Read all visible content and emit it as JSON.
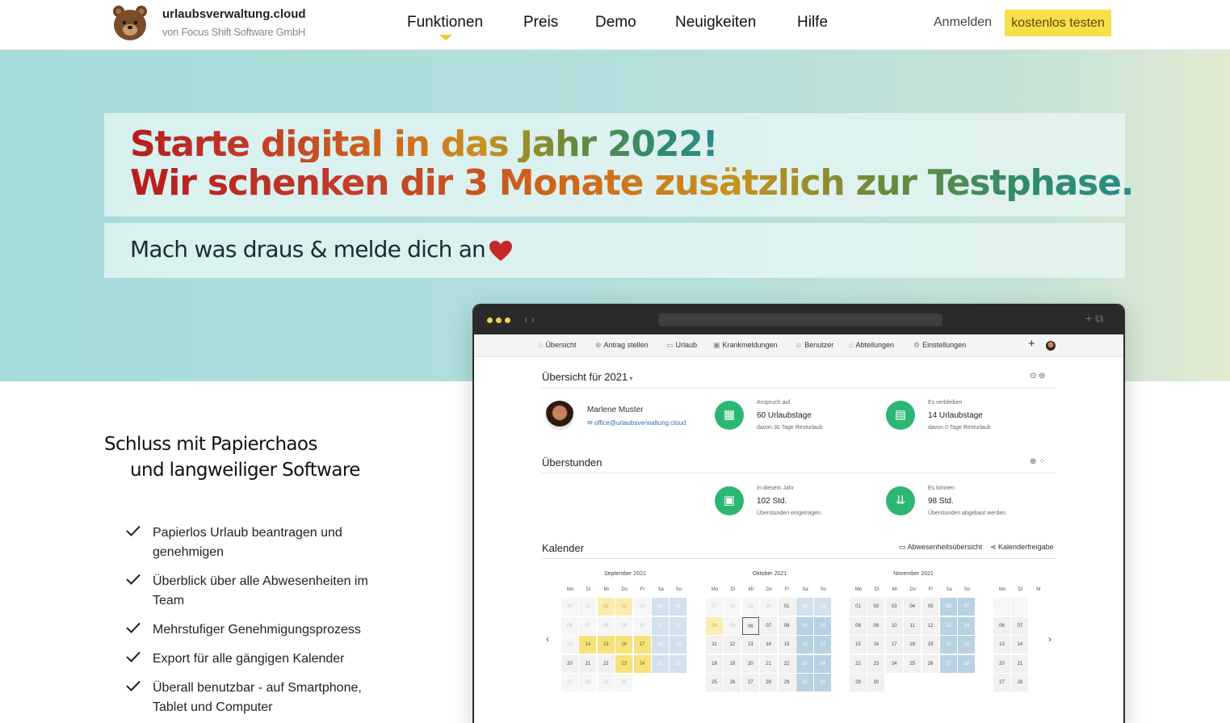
{
  "header": {
    "brand": "urlaubsverwaltung.cloud",
    "brand_sub": "von Focus Shift Software GmbH",
    "nav": [
      "Funktionen",
      "Preis",
      "Demo",
      "Neuigkeiten",
      "Hilfe"
    ],
    "active_nav": "Funktionen",
    "login": "Anmelden",
    "cta": "kostenlos testen"
  },
  "hero": {
    "headline_1": "Starte digital in das Jahr 2022!",
    "headline_2": "Wir schenken dir 3 Monate zusätzlich zur Testphase.",
    "tagline": "Mach was draus & melde dich an"
  },
  "features": {
    "claim_1": "Schluss mit Papierchaos",
    "claim_2": "und langweiliger Software",
    "items": [
      "Papierlos Urlaub beantragen und genehmigen",
      "Überblick über alle Abwesenheiten im Team",
      "Mehrstufiger Genehmigungsprozess",
      "Export für alle gängigen Kalender",
      "Überall benutzbar - auf Smartphone, Tablet und Computer"
    ]
  },
  "app": {
    "nav": [
      "Übersicht",
      "Antrag stellen",
      "Urlaub",
      "Krankmeldungen",
      "Benutzer",
      "Abteilungen",
      "Einstellungen"
    ],
    "overview_title": "Übersicht für 2021",
    "user_name": "Marlene Muster",
    "user_email": "office@urlaubsverwaltung.cloud",
    "claim_label": "Anspruch auf",
    "claim_value": "60 Urlaubstage",
    "claim_sub": "davon 30 Tage Resturlaub",
    "remain_label": "Es verbleiben",
    "remain_value": "14 Urlaubstage",
    "remain_sub": "davon 0 Tage Resturlaub",
    "overtime_title": "Überstunden",
    "ot_year_label": "In diesem Jahr",
    "ot_year_value": "102 Std.",
    "ot_year_sub": "Überstunden eingetragen.",
    "ot_can_label": "Es können",
    "ot_can_value": "98 Std.",
    "ot_can_sub": "Überstunden abgebaut werden.",
    "calendar_title": "Kalender",
    "cal_link_1": "Abwesenheitsübersicht",
    "cal_link_2": "Kalenderfreigabe",
    "months": [
      "September 2021",
      "Oktober 2021",
      "November 2021"
    ],
    "weekdays": [
      "Mo",
      "Di",
      "Mi",
      "Do",
      "Fr",
      "Sa",
      "So"
    ],
    "partial_weekdays": [
      "Mo",
      "Di",
      "M"
    ]
  },
  "colors": {
    "accent_yellow": "#f5e04a",
    "icon_green": "#2bb673",
    "heart_red": "#c62828"
  }
}
